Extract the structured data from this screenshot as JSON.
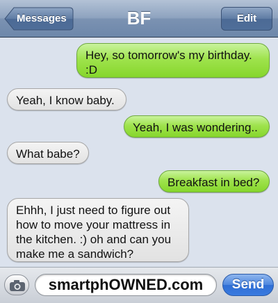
{
  "header": {
    "back_label": "Messages",
    "title": "BF",
    "edit_label": "Edit"
  },
  "messages": [
    {
      "sender": "me",
      "text": "Hey, so tomorrow's my birthday. :D"
    },
    {
      "sender": "them",
      "text": "Yeah, I know baby."
    },
    {
      "sender": "me",
      "text": "Yeah, I was wondering.."
    },
    {
      "sender": "them",
      "text": "What babe?"
    },
    {
      "sender": "me",
      "text": "Breakfast in bed?"
    },
    {
      "sender": "them",
      "text": "Ehhh, I just need to figure out how to move your mattress in the kitchen. :) oh and can you make me a sandwich?"
    }
  ],
  "input": {
    "value": "smartphOWNED.com",
    "send_label": "Send",
    "camera_icon": "camera-icon"
  },
  "colors": {
    "outgoing_bubble": "#9fe34d",
    "incoming_bubble": "#e8e8e8",
    "background": "#dbe2ed",
    "send_button": "#3a7be0"
  }
}
